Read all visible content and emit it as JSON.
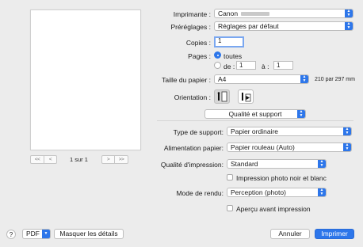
{
  "preview": {
    "page_counter": "1 sur 1",
    "first_glyph": "<<",
    "prev_glyph": "<",
    "next_glyph": ">",
    "last_glyph": ">>"
  },
  "printer": {
    "label": "Imprimante :",
    "value": "Canon"
  },
  "presets": {
    "label": "Préréglages :",
    "value": "Réglages par défaut"
  },
  "copies": {
    "label": "Copies :",
    "value": "1"
  },
  "pages": {
    "label": "Pages :",
    "all_label": "toutes",
    "from_label": "de :",
    "from_value": "1",
    "to_label": "à :",
    "to_value": "1"
  },
  "paper_size": {
    "label": "Taille du papier :",
    "value": "A4",
    "dimensions": "210 par 297 mm"
  },
  "orientation": {
    "label": "Orientation :"
  },
  "section_menu": {
    "value": "Qualité et support"
  },
  "media_type": {
    "label": "Type de support:",
    "value": "Papier ordinaire"
  },
  "paper_source": {
    "label": "Alimentation papier:",
    "value": "Papier rouleau (Auto)"
  },
  "print_quality": {
    "label": "Qualité d'impression:",
    "value": "Standard"
  },
  "bw_photo": {
    "label": "Impression photo noir et blanc"
  },
  "rendering": {
    "label": "Mode de rendu:",
    "value": "Perception (photo)"
  },
  "preview_check": {
    "label": "Aperçu avant impression"
  },
  "footer": {
    "help": "?",
    "pdf": "PDF",
    "hide_details": "Masquer les détails",
    "cancel": "Annuler",
    "print": "Imprimer"
  },
  "colors": {
    "accent": "#2d76ea",
    "background": "#ececec"
  }
}
